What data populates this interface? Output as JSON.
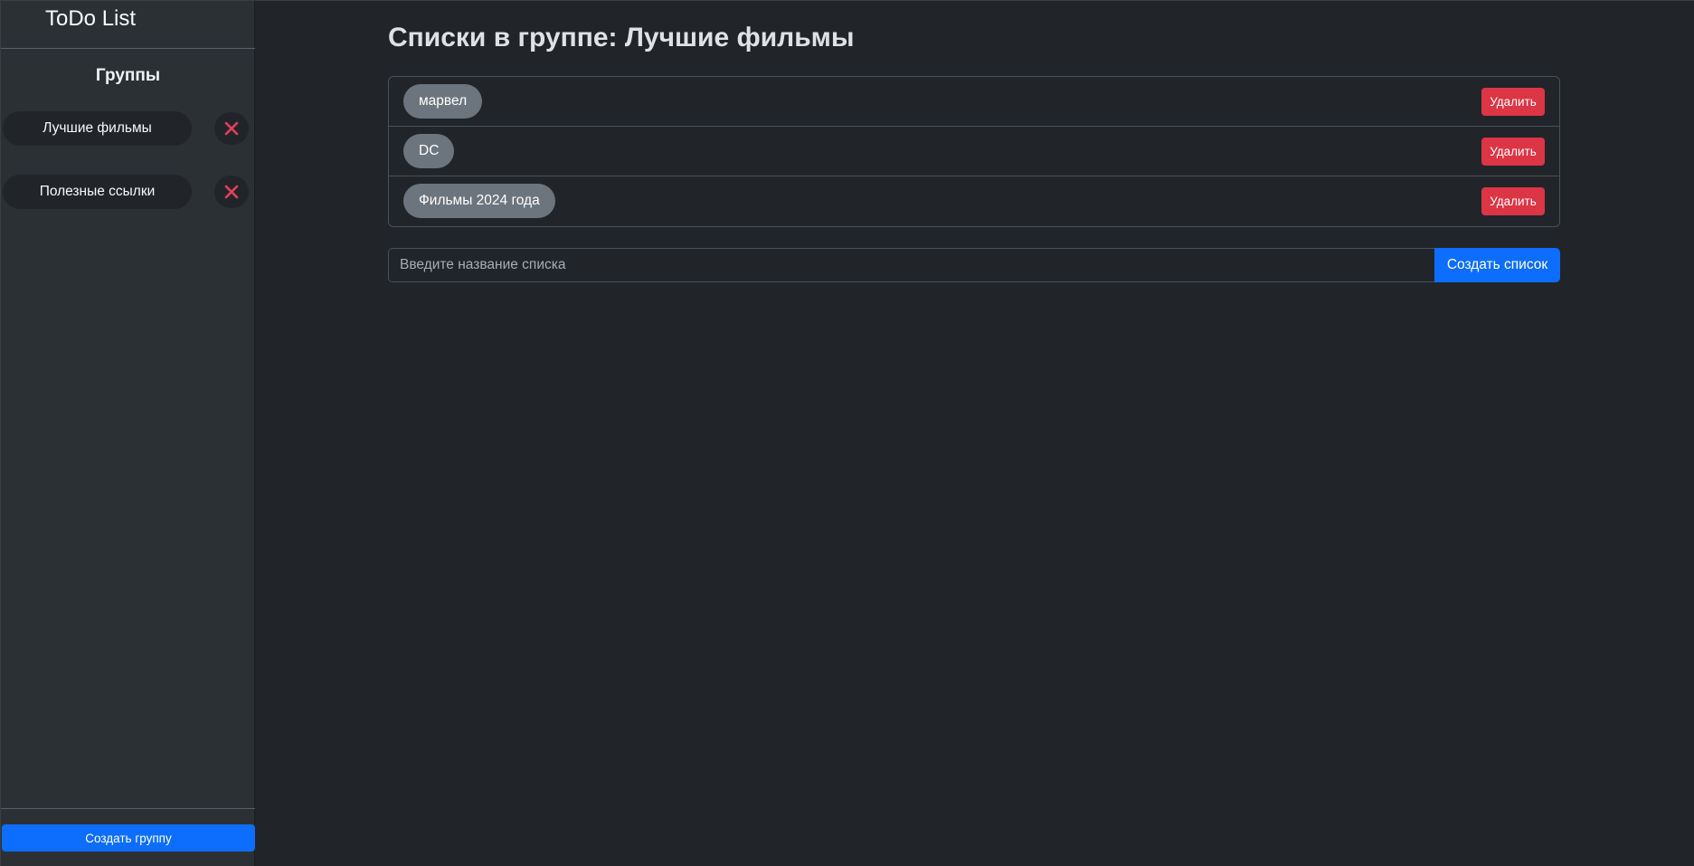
{
  "app": {
    "title": "ToDo List"
  },
  "sidebar": {
    "groups_title": "Группы",
    "groups": [
      {
        "label": "Лучшие фильмы",
        "delete_icon": "close-icon"
      },
      {
        "label": "Полезные ссылки",
        "delete_icon": "close-icon"
      }
    ],
    "create_group_label": "Создать группу"
  },
  "main": {
    "title": "Списки в группе: Лучшие фильмы",
    "lists": [
      {
        "name": "марвел",
        "delete_label": "Удалить"
      },
      {
        "name": "DC",
        "delete_label": "Удалить"
      },
      {
        "name": "Фильмы 2024 года",
        "delete_label": "Удалить"
      }
    ],
    "create": {
      "placeholder": "Введите название списка",
      "value": "",
      "button_label": "Создать список"
    }
  },
  "colors": {
    "background": "#212529",
    "sidebar": "#2b3035",
    "primary": "#0d6efd",
    "danger": "#dc3545",
    "pill": "#6c757d",
    "close_icon": "#e83e5c"
  }
}
